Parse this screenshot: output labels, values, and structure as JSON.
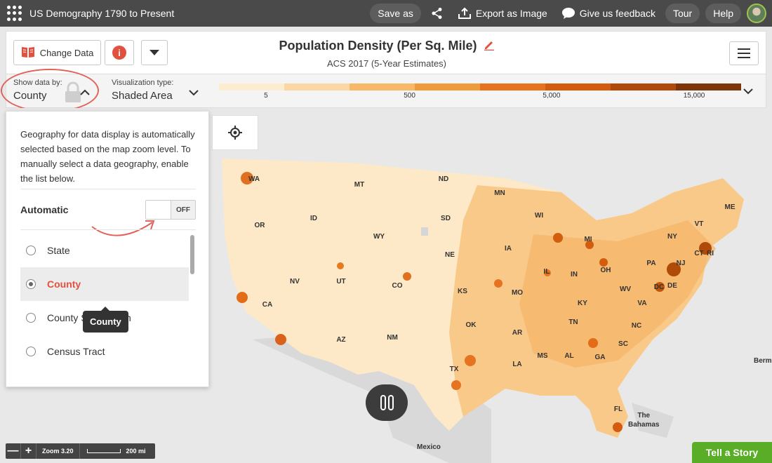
{
  "app": {
    "title": "US Demography 1790 to Present"
  },
  "topbar": {
    "save_as": "Save as",
    "export": "Export as Image",
    "feedback": "Give us feedback",
    "tour": "Tour",
    "help": "Help"
  },
  "header": {
    "change_data": "Change Data",
    "info": "i",
    "title": "Population Density (Per Sq. Mile)",
    "subtitle": "ACS 2017 (5-Year Estimates)"
  },
  "controls": {
    "show_by_label": "Show data by:",
    "show_by_value": "County",
    "viz_label": "Visualization type:",
    "viz_value": "Shaded Area",
    "legend_colors": [
      "#fcecd0",
      "#fbd7a5",
      "#f7b968",
      "#f09a3e",
      "#e5731f",
      "#d45c0e",
      "#b04a08",
      "#7d3406"
    ],
    "legend_ticks": [
      "5",
      "500",
      "5,000",
      "15,000"
    ]
  },
  "geo_panel": {
    "description": "Geography for data display is automatically selected based on the map zoom level. To manually select a data geography, enable the list below.",
    "automatic_label": "Automatic",
    "toggle_text": "OFF",
    "items": [
      "State",
      "County",
      "County Subdivision",
      "Census Tract"
    ],
    "selected": "County",
    "tooltip": "County"
  },
  "map": {
    "state_labels": [
      "WA",
      "MT",
      "ND",
      "MN",
      "ME",
      "OR",
      "ID",
      "SD",
      "WI",
      "VT",
      "WY",
      "MI",
      "NY",
      "CT",
      "RI",
      "NE",
      "IA",
      "PA",
      "NJ",
      "IL",
      "IN",
      "OH",
      "NV",
      "UT",
      "CO",
      "MO",
      "WV",
      "DC",
      "DE",
      "CA",
      "KS",
      "KY",
      "VA",
      "TN",
      "NC",
      "OK",
      "AR",
      "AZ",
      "NM",
      "SC",
      "MS",
      "AL",
      "GA",
      "LA",
      "TX",
      "FL"
    ],
    "mexico": "Mexico",
    "bahamas_1": "The",
    "bahamas_2": "Bahamas",
    "bermuda": "Berm"
  },
  "zoom": {
    "minus": "—",
    "plus": "+",
    "level": "Zoom 3.20",
    "scale": "200 mi"
  },
  "story": {
    "label": "Tell a Story"
  }
}
